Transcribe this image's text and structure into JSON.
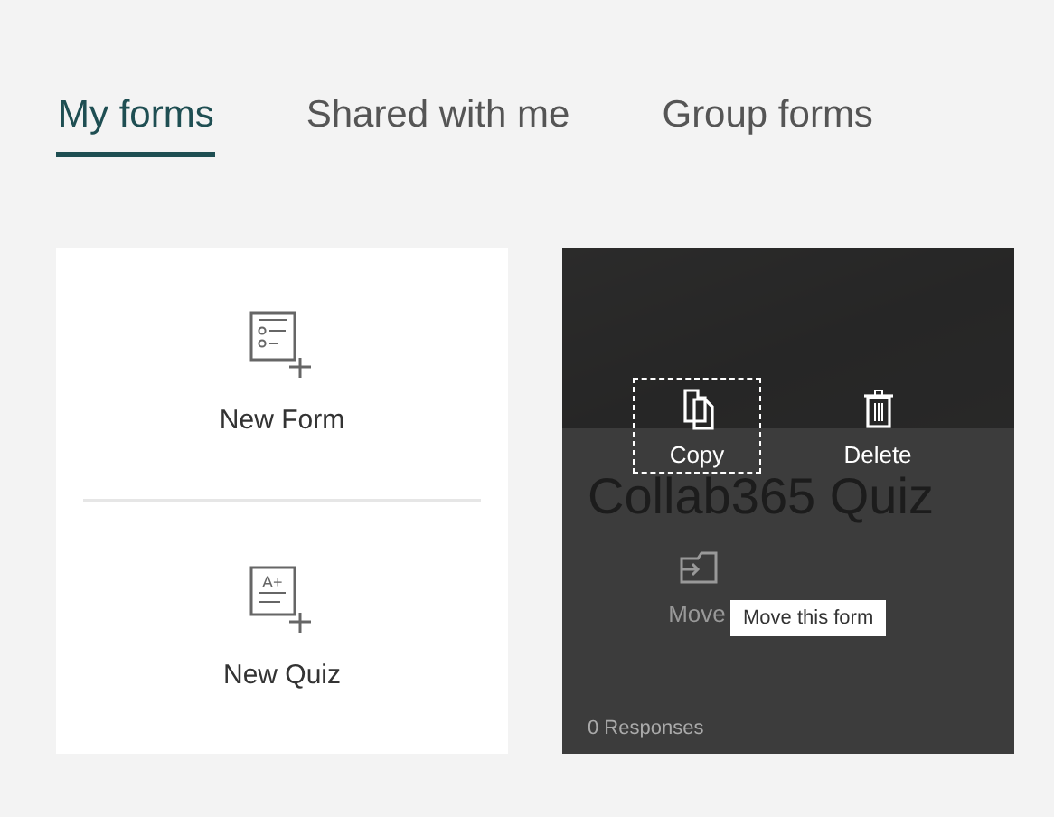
{
  "tabs": [
    {
      "label": "My forms",
      "selected": true
    },
    {
      "label": "Shared with me",
      "selected": false
    },
    {
      "label": "Group forms",
      "selected": false
    }
  ],
  "create_items": [
    {
      "kind": "form",
      "label": "New Form"
    },
    {
      "kind": "quiz",
      "label": "New Quiz",
      "icon_text": "A+"
    }
  ],
  "form_card": {
    "title": "Collab365 Quiz",
    "responses": "0 Responses",
    "actions": [
      {
        "kind": "copy",
        "label": "Copy",
        "focused": true,
        "disabled": false
      },
      {
        "kind": "delete",
        "label": "Delete",
        "focused": false,
        "disabled": false
      },
      {
        "kind": "move",
        "label": "Move",
        "focused": false,
        "disabled": true
      }
    ],
    "tooltip": "Move this form"
  }
}
